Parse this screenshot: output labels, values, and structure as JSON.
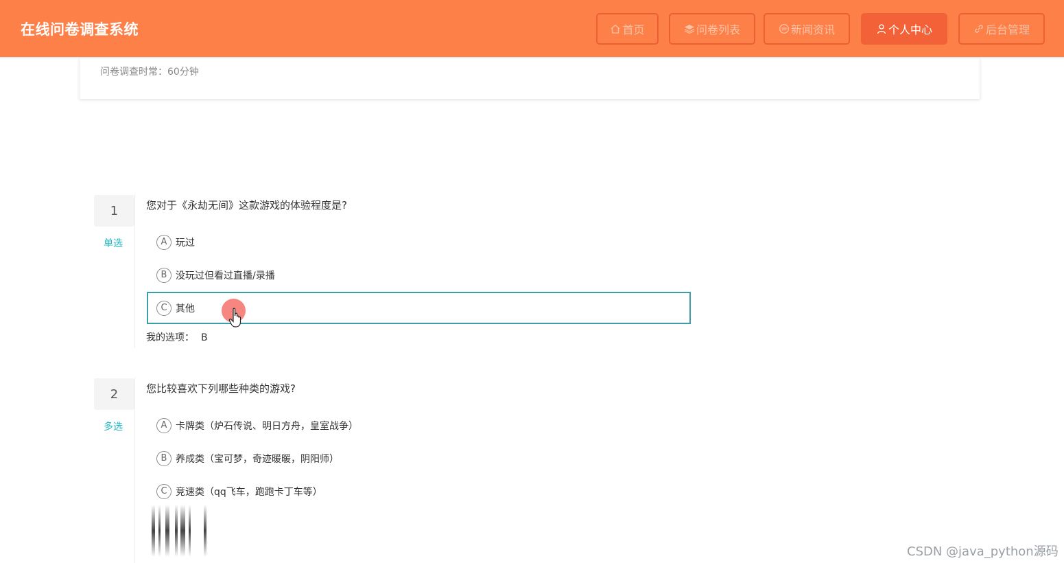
{
  "header": {
    "brand": "在线问卷调查系统",
    "nav": [
      {
        "label": "首页",
        "icon": "home-icon"
      },
      {
        "label": "问卷列表",
        "icon": "layers-icon"
      },
      {
        "label": "新闻资讯",
        "icon": "news-icon"
      },
      {
        "label": "个人中心",
        "icon": "user-icon",
        "active": true
      },
      {
        "label": "后台管理",
        "icon": "link-icon"
      }
    ]
  },
  "survey": {
    "duration_text": "问卷调查时常：60分钟"
  },
  "questions": [
    {
      "number": "1",
      "type": "单选",
      "text": "您对于《永劫无间》这款游戏的体验程度是?",
      "options": [
        {
          "letter": "A",
          "label": "玩过"
        },
        {
          "letter": "B",
          "label": "没玩过但看过直播/录播"
        },
        {
          "letter": "C",
          "label": "其他"
        }
      ],
      "my_choice_label": "我的选项：",
      "my_choice_value": "B"
    },
    {
      "number": "2",
      "type": "多选",
      "text": "您比较喜欢下列哪些种类的游戏?",
      "options": [
        {
          "letter": "A",
          "label": "卡牌类（炉石传说、明日方舟，皇室战争）"
        },
        {
          "letter": "B",
          "label": "养成类（宝可梦，奇迹暖暖，阴阳师）"
        },
        {
          "letter": "C",
          "label": "竞速类（qq飞车，跑跑卡丁车等）"
        }
      ]
    }
  ],
  "watermark": "CSDN @java_python源码",
  "colors": {
    "header_bg": "#fd8048",
    "nav_active_bg": "#f26137",
    "accent_teal": "#1fb8c4",
    "hover_border": "#3d9ea5"
  }
}
